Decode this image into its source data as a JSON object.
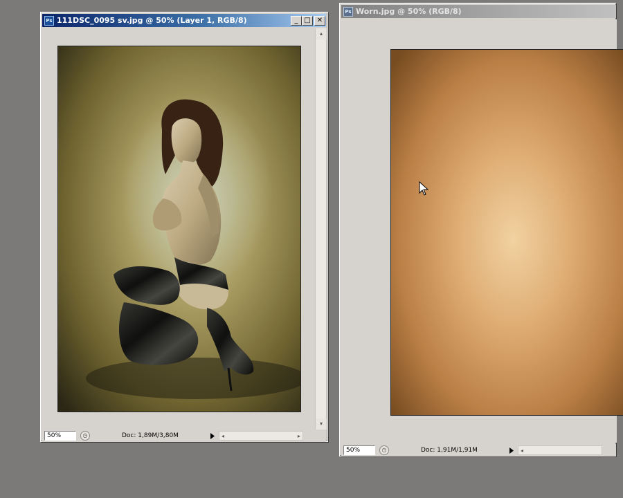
{
  "window1": {
    "title": "111DSC_0095 sv.jpg @ 50% (Layer 1, RGB/8)",
    "app_icon_label": "Ps",
    "minimize_label": "_",
    "maximize_label": "□",
    "close_label": "✕",
    "zoom": "50%",
    "doc_label": "Doc:",
    "doc_size": "1,89M/3,80M",
    "scroll_left": "◂",
    "scroll_right": "▸",
    "scroll_up": "▴",
    "scroll_down": "▾"
  },
  "window2": {
    "title": "Worn.jpg @ 50% (RGB/8)",
    "app_icon_label": "Ps",
    "zoom": "50%",
    "doc_label": "Doc:",
    "doc_size": "1,91M/1,91M",
    "scroll_left": "◂"
  },
  "icons": {
    "photoshop": "photoshop-icon",
    "status_info": "status-info-icon",
    "status_menu": "status-menu-triangle-icon",
    "cursor": "mouse-pointer-icon"
  },
  "colors": {
    "active_title_start": "#0a246a",
    "active_title_end": "#a6caf0",
    "inactive_title": "#a8a8a8",
    "workspace_bg": "#7b7a78",
    "window_bg": "#d6d3ce"
  }
}
